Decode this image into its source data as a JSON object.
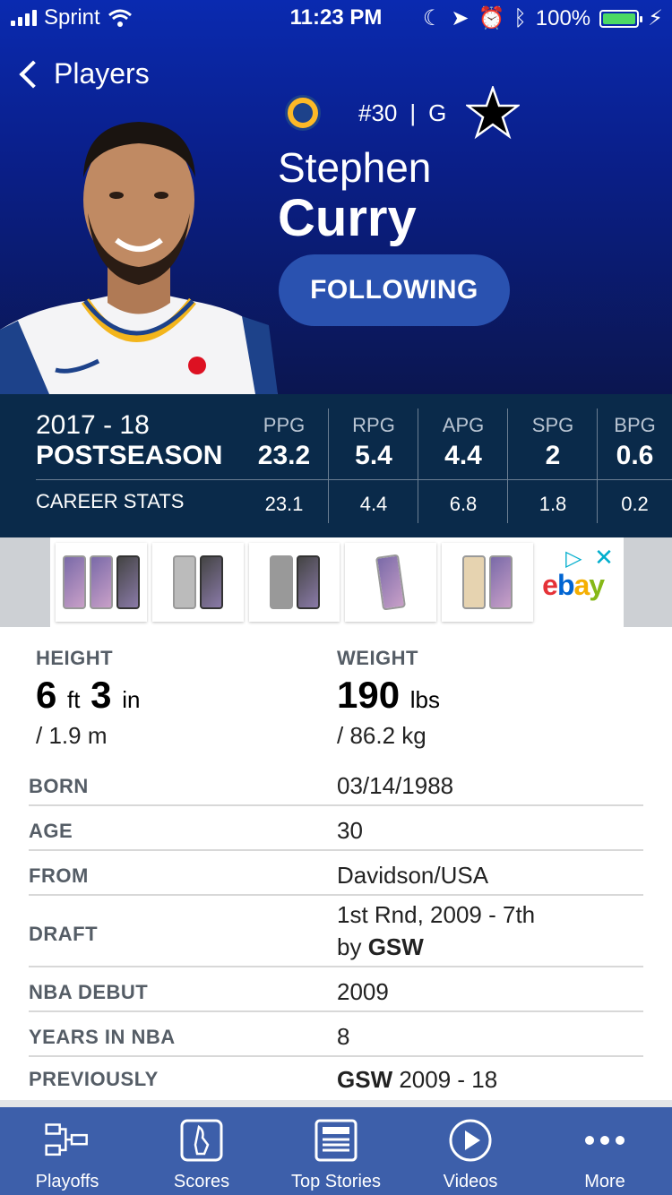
{
  "status_bar": {
    "carrier": "Sprint",
    "time": "11:23 PM",
    "battery": "100%"
  },
  "nav": {
    "back_label": "Players"
  },
  "player": {
    "number": "#30",
    "separator": "|",
    "position": "G",
    "first_name": "Stephen",
    "last_name": "Curry",
    "follow_label": "FOLLOWING"
  },
  "stats": {
    "season": "2017 - 18",
    "season_type": "POSTSEASON",
    "career_label": "CAREER STATS",
    "columns": [
      {
        "label": "PPG",
        "season": "23.2",
        "career": "23.1"
      },
      {
        "label": "RPG",
        "season": "5.4",
        "career": "4.4"
      },
      {
        "label": "APG",
        "season": "4.4",
        "career": "6.8"
      },
      {
        "label": "SPG",
        "season": "2",
        "career": "1.8"
      },
      {
        "label": "BPG",
        "season": "0.6",
        "career": "0.2"
      }
    ]
  },
  "ad": {
    "brand": [
      "e",
      "b",
      "a",
      "y"
    ],
    "choice_icon": "▷",
    "close_icon": "✕"
  },
  "bio": {
    "height_label": "HEIGHT",
    "height_ft": "6",
    "ft_unit": "ft",
    "height_in": "3",
    "in_unit": "in",
    "height_metric": "/ 1.9 m",
    "weight_label": "WEIGHT",
    "weight_lbs": "190",
    "lbs_unit": "lbs",
    "weight_metric": "/ 86.2 kg",
    "rows": [
      {
        "key": "BORN",
        "value": "03/14/1988"
      },
      {
        "key": "AGE",
        "value": "30"
      },
      {
        "key": "FROM",
        "value": "Davidson/USA"
      },
      {
        "key": "DRAFT",
        "value_line1": "1st Rnd, 2009 - 7th",
        "value_line2_prefix": "by ",
        "value_line2_bold": "GSW"
      },
      {
        "key": "NBA DEBUT",
        "value": "2009"
      },
      {
        "key": "YEARS IN NBA",
        "value": "8"
      },
      {
        "key": "PREVIOUSLY",
        "value_bold": "GSW",
        "value_rest": " 2009 - 18"
      }
    ]
  },
  "tabs": [
    {
      "label": "Playoffs",
      "icon": "bracket-icon"
    },
    {
      "label": "Scores",
      "icon": "nba-logo-icon"
    },
    {
      "label": "Top Stories",
      "icon": "newspaper-icon"
    },
    {
      "label": "Videos",
      "icon": "play-icon"
    },
    {
      "label": "More",
      "icon": "more-icon"
    }
  ]
}
